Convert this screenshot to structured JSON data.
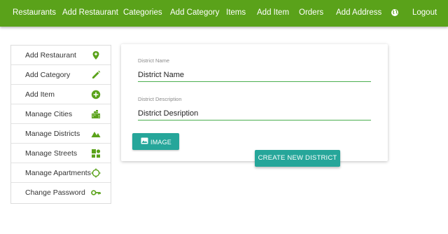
{
  "nav": {
    "items": [
      {
        "label": "Restaurants"
      },
      {
        "label": "Add Restaurant"
      },
      {
        "label": "Categories"
      },
      {
        "label": "Add Category"
      },
      {
        "label": "Items"
      },
      {
        "label": "Add Item"
      },
      {
        "label": "Orders"
      },
      {
        "label": "Add Address"
      }
    ],
    "globe_icon": "globe-icon",
    "logout": "Logout",
    "bar_color": "#5aa21a"
  },
  "sidebar": {
    "items": [
      {
        "label": "Add Restaurant",
        "icon": "location-pin-add-icon"
      },
      {
        "label": "Add Category",
        "icon": "pencil-icon"
      },
      {
        "label": "Add Item",
        "icon": "plus-circle-icon"
      },
      {
        "label": "Manage Cities",
        "icon": "city-icon"
      },
      {
        "label": "Manage Districts",
        "icon": "terrain-icon"
      },
      {
        "label": "Manage Streets",
        "icon": "streets-icon"
      },
      {
        "label": "Manage Apartments",
        "icon": "crosshair-icon"
      },
      {
        "label": "Change Password",
        "icon": "key-icon"
      }
    ],
    "icon_color": "#5aa21a"
  },
  "form": {
    "district_name": {
      "label": "District Name",
      "value": "District Name"
    },
    "district_description": {
      "label": "District Description",
      "value": "District Desription"
    },
    "image_button": "IMAGE",
    "create_button": "CREATE NEW DISTRICT",
    "button_color": "#26a69a",
    "underline_color": "#4caf50"
  }
}
